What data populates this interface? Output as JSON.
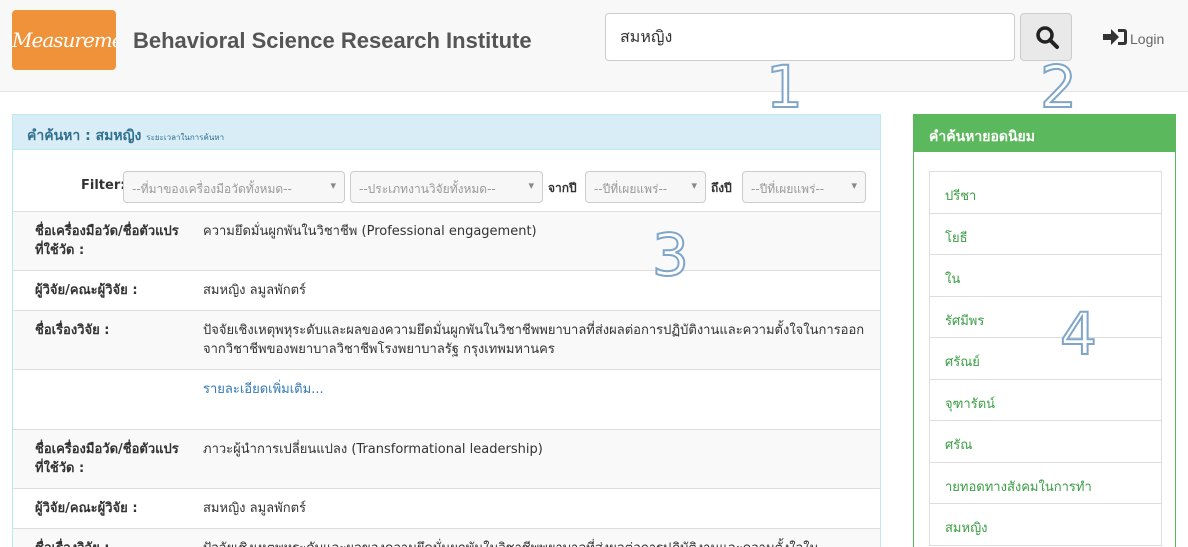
{
  "header": {
    "logo_text": "Measurement",
    "site_title": "Behavioral Science Research Institute",
    "search_value": "สมหญิง",
    "login_label": "Login"
  },
  "overlay_numbers": [
    "1",
    "2",
    "3",
    "4"
  ],
  "results_panel": {
    "heading_prefix": "คำค้นหา :",
    "heading_term": "สมหญิง",
    "heading_small": "ระยะเวลาในการค้นหา"
  },
  "filters": {
    "label": "Filter:",
    "source": "--ที่มาของเครื่องมือวัดทั้งหมด--",
    "type": "--ประเภทงานวิจัยทั้งหมด--",
    "from_label": "จากปี",
    "from_year": "--ปีที่เผยแพร่--",
    "to_label": "ถึงปี",
    "to_year": "--ปีที่เผยแพร่--"
  },
  "results": [
    {
      "instrument_label": "ชื่อเครื่องมือวัด/ชื่อตัวแปรที่ใช้วัด :",
      "instrument": "ความยึดมั่นผูกพันในวิชาชีพ (Professional engagement)",
      "researcher_label": "ผู้วิจัย/คณะผู้วิจัย :",
      "researcher": "สมหญิง ลมูลพักตร์",
      "title_label": "ชื่อเรื่องวิจัย :",
      "title": "ปัจจัยเชิงเหตุพหุระดับและผลของความยึดมั่นผูกพันในวิชาชีพพยาบาลที่ส่งผลต่อการปฏิบัติงานและความตั้งใจในการออกจากวิชาชีพของพยาบาลวิชาชีพโรงพยาบาลรัฐ กรุงเทพมหานคร",
      "more_link": "รายละเอียดเพิ่มเติม..."
    },
    {
      "instrument_label": "ชื่อเครื่องมือวัด/ชื่อตัวแปรที่ใช้วัด :",
      "instrument": "ภาวะผู้นำการเปลี่ยนแปลง (Transformational leadership)",
      "researcher_label": "ผู้วิจัย/คณะผู้วิจัย :",
      "researcher": "สมหญิง ลมูลพักตร์",
      "title_label": "ชื่อเรื่องวิจัย :",
      "title": "ปัจจัยเชิงเหตุพหุระดับและผลของความยึดมั่นผูกพันในวิชาชีพพยาบาลที่ส่งผลต่อการปฏิบัติงานและความตั้งใจใน"
    }
  ],
  "popular": {
    "heading": "คำค้นหายอดนิยม",
    "items": [
      "ปรีชา",
      "โยธี",
      "ใน",
      "รัศมีพร",
      "ศรัณย์",
      "จุฑารัตน์",
      "ศรัณ",
      "ายทอดทางสังคมในการทำ",
      "สมหญิง"
    ]
  },
  "colors": {
    "logo": "#f0923a",
    "info_heading": "#d9edf7",
    "success": "#5cb85c",
    "link": "#337ab7"
  }
}
